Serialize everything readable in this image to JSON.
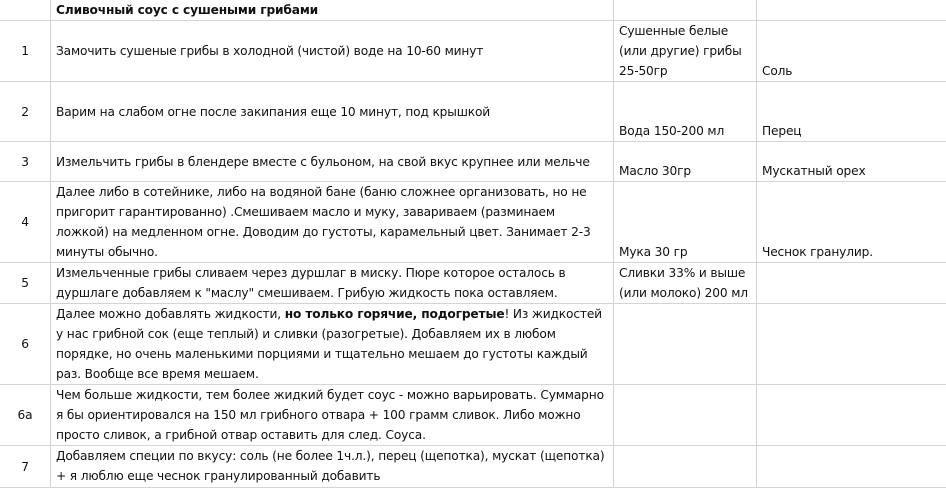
{
  "title": "Сливочный соус с сушеными грибами",
  "rows": [
    {
      "num": "1",
      "step": "Замочить сушеные грибы в холодной (чистой) воде на 10-60 минут",
      "ingredient": "Сушенные белые (или другие) грибы 25-50гр",
      "seasoning": "Соль"
    },
    {
      "num": "2",
      "step": "Варим на слабом огне после закипания еще 10 минут, под крышкой",
      "ingredient": "Вода 150-200 мл",
      "seasoning": "Перец"
    },
    {
      "num": "3",
      "step": "Измельчить грибы в блендере вместе с бульоном, на свой вкус крупнее или мельче",
      "ingredient": "Масло 30гр",
      "seasoning": "Мускатный орех"
    },
    {
      "num": "4",
      "step": "Далее либо в сотейнике, либо на водяной бане (баню сложнее организовать, но не пригорит гарантированно) .Смешиваем масло и муку, завариваем (разминаем ложкой) на медленном огне. Доводим до густоты, карамельный цвет. Занимает 2-3 минуты обычно.",
      "ingredient": "Мука 30 гр",
      "seasoning": "Чеснок гранулир."
    },
    {
      "num": "5",
      "step": "Измельченные грибы сливаем через дуршлаг в миску. Пюре которое осталось в дуршлаге добавляем к \"маслу\" смешиваем. Грибую жидкость пока оставляем.",
      "ingredient": "Сливки 33% и выше (или молоко) 200 мл",
      "seasoning": ""
    },
    {
      "num": "6",
      "step_before": "Далее можно добавлять жидкости, ",
      "step_bold": "но только горячие, подогретые",
      "step_after": "! Из жидкостей у нас грибной сок (еще теплый) и сливки (разогретые). Добавляем их в любом порядке, но очень маленькими порциями и тщательно мешаем до густоты каждый раз. Вообще все время мешаем.",
      "ingredient": "",
      "seasoning": ""
    },
    {
      "num": "6а",
      "step": "Чем больше жидкости, тем более жидкий будет соус - можно варьировать. Суммарно я бы ориентировался на 150 мл грибного отвара + 100 грамм сливок. Либо можно просто сливок, а грибной отвар оставить для след. Соуса.",
      "ingredient": "",
      "seasoning": ""
    },
    {
      "num": "7",
      "step": "Добавляем специи по вкусу: соль (не более 1ч.л.), перец (щепотка), мускат (щепотка) + я люблю еще чеснок гранулированный добавить",
      "ingredient": "",
      "seasoning": ""
    }
  ]
}
